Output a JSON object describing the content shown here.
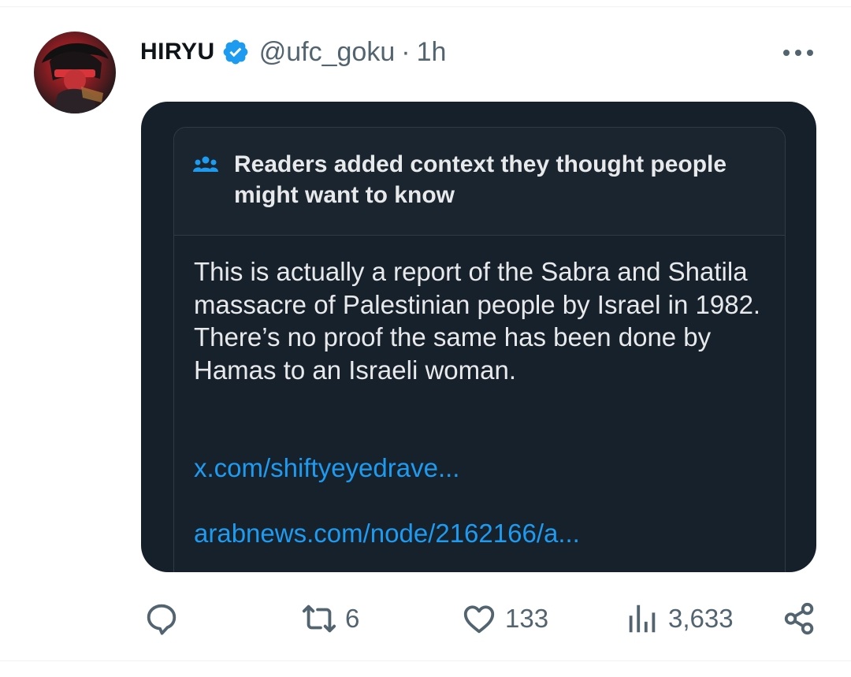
{
  "tweet": {
    "display_name": "HIRYU",
    "handle": "@ufc_goku",
    "separator": "·",
    "time": "1h",
    "verified": true,
    "avatar": "avatar-image"
  },
  "community_note": {
    "title": "Readers added context they thought people might want to know",
    "body_line_1": "This is actually a report of the Sabra and Shatila massacre of Palestinian people by Israel in 1982.",
    "body_line_2": "There’s no proof the same has been done by Hamas to an Israeli woman.",
    "link_1": "x.com/shiftyeyedrave...",
    "link_2": "arabnews.com/node/2162166/a...",
    "icon": "people-icon"
  },
  "actions": {
    "reply_count": "",
    "retweet_count": "6",
    "like_count": "133",
    "views_count": "3,633"
  },
  "colors": {
    "accent": "#1d9bf0",
    "card_bg": "#15202b",
    "text_dark": "#0f1419",
    "text_muted": "#536471"
  }
}
